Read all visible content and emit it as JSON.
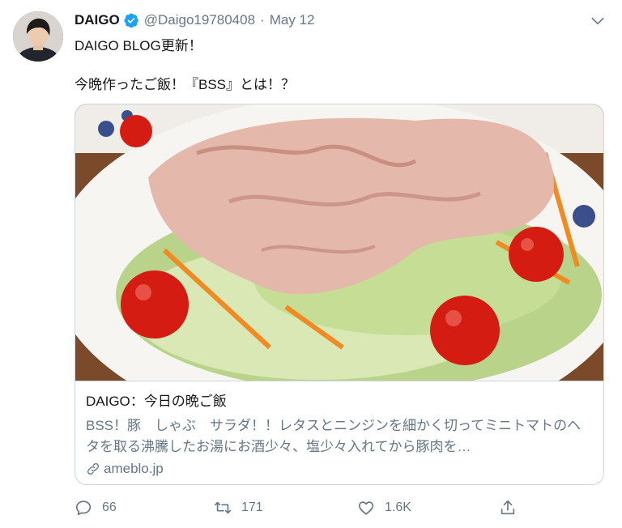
{
  "tweet": {
    "author_name": "DAIGO",
    "handle": "@Daigo19780408",
    "separator": "·",
    "date": "May 12",
    "lines": [
      "DAIGO BLOG更新！",
      "今晩作ったご飯！『BSS』とは！？"
    ]
  },
  "card": {
    "image_icon": "salad-photo",
    "title": "DAIGO：今日の晩ご飯",
    "description": "BSS！豚　しゃぶ　サラダ！！レタスとニンジンを細かく切ってミニトマトのヘタを取る沸騰したお湯にお酒少々、塩少々入れてから豚肉を…",
    "domain": "ameblo.jp"
  },
  "actions": {
    "replies": "66",
    "retweets": "171",
    "likes": "1.6K"
  },
  "icons": {
    "verified": "verified-badge-icon",
    "caret": "chevron-down-icon",
    "reply": "reply-icon",
    "retweet": "retweet-icon",
    "like": "heart-icon",
    "share": "share-icon",
    "link": "link-icon"
  },
  "colors": {
    "verified": "#1da1f2",
    "secondary_text": "#657786",
    "border": "#ccd6dd"
  }
}
